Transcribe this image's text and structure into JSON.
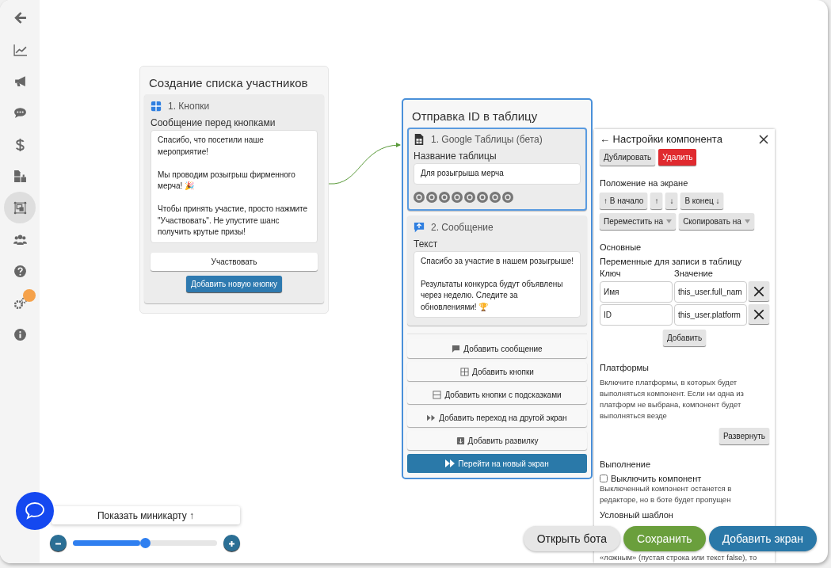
{
  "sidebar": {
    "items": [
      {
        "kind": "back",
        "selected": false,
        "badge": false
      },
      {
        "kind": "chart",
        "selected": false,
        "badge": false
      },
      {
        "kind": "megaphone",
        "selected": false,
        "badge": false
      },
      {
        "kind": "chat",
        "selected": false,
        "badge": false
      },
      {
        "kind": "dollar",
        "selected": false,
        "badge": false
      },
      {
        "kind": "files",
        "selected": false,
        "badge": false
      },
      {
        "kind": "screens",
        "selected": true,
        "badge": false
      },
      {
        "kind": "users",
        "selected": false,
        "badge": false
      },
      {
        "kind": "help",
        "selected": false,
        "badge": false
      },
      {
        "kind": "gears",
        "selected": false,
        "badge": true
      },
      {
        "kind": "info",
        "selected": false,
        "badge": false
      }
    ]
  },
  "screens": [
    {
      "title": "Создание списка участников",
      "selected": false,
      "components": [
        {
          "kind": "buttons",
          "title": "1. Кнопки",
          "selected": false,
          "field_label": "Сообщение перед кнопками",
          "text": "Спасибо, что посетили наше мероприятие!\n\nМы проводим розыгрыш фирменного мерча! 🎉\n\nЧтобы принять участие, просто нажмите \"Участвовать\". Не упустите шанс получить крутые призы!",
          "buttons": [
            "Участвовать"
          ],
          "add_button": "Добавить новую кнопку"
        }
      ]
    },
    {
      "title": "Отправка ID в таблицу",
      "selected": true,
      "components": [
        {
          "kind": "sheets",
          "title": "1. Google Таблицы (бета)",
          "selected": true,
          "field_label": "Название таблицы",
          "text": "Для розыгрыша мерча"
        },
        {
          "kind": "message",
          "title": "2. Сообщение",
          "selected": false,
          "field_label": "Текст",
          "text": "Спасибо за участие в нашем розыгрыше!\n\nРезультаты конкурса будут объявлены через неделю. Следите за обновлениями! 🏆"
        }
      ],
      "add_actions": [
        {
          "kind": "message",
          "label": "Добавить сообщение"
        },
        {
          "kind": "buttons",
          "label": "Добавить кнопки"
        },
        {
          "kind": "hints",
          "label": "Добавить кнопки с подсказками"
        },
        {
          "kind": "jump",
          "label": "Добавить переход на другой экран"
        },
        {
          "kind": "fork",
          "label": "Добавить развилку"
        }
      ],
      "goto_button": "Перейти на новый экран"
    }
  ],
  "settings": {
    "title": "← Настройки компонента",
    "actions": [
      {
        "kind": "default",
        "label": "Дублировать"
      },
      {
        "kind": "danger",
        "label": "Удалить"
      }
    ],
    "position_label": "Положение на экране",
    "position_buttons": [
      "↑ В начало",
      "↑",
      "↓",
      "В конец ↓"
    ],
    "dropdowns": [
      "Переместить на",
      "Скопировать на"
    ],
    "section_main": "Основные",
    "variables_label": "Переменные для записи в таблицу",
    "key_header": "Ключ",
    "value_header": "Значение",
    "variables": [
      {
        "key": "Имя",
        "value": "this_user.full_nam"
      },
      {
        "key": "ID",
        "value": "this_user.platform"
      }
    ],
    "add_label": "Добавить",
    "platforms_title": "Платформы",
    "platforms_hint": "Включите платформы, в которых будет выполняться компонент. Если ни одна из платформ не выбрана, компонент будет выполняться везде",
    "expand_button": "Развернуть",
    "execution_title": "Выполнение",
    "disable_checkbox": {
      "label": "Выключить компонент",
      "checked": false
    },
    "disable_hint": "Выключенный компонент останется в редакторе, но в боте будет пропущен",
    "template_title": "Условный шаблон",
    "template_hint": "«ложным» (пустая строка или текст false), то"
  },
  "minimap_button": "Показать миникарту ↑",
  "zoom": {
    "level": 0.5
  },
  "footer_buttons": [
    {
      "kind": "secondary",
      "label": "Открыть бота"
    },
    {
      "kind": "success",
      "label": "Сохранить"
    },
    {
      "kind": "primary",
      "label": "Добавить экран"
    }
  ]
}
